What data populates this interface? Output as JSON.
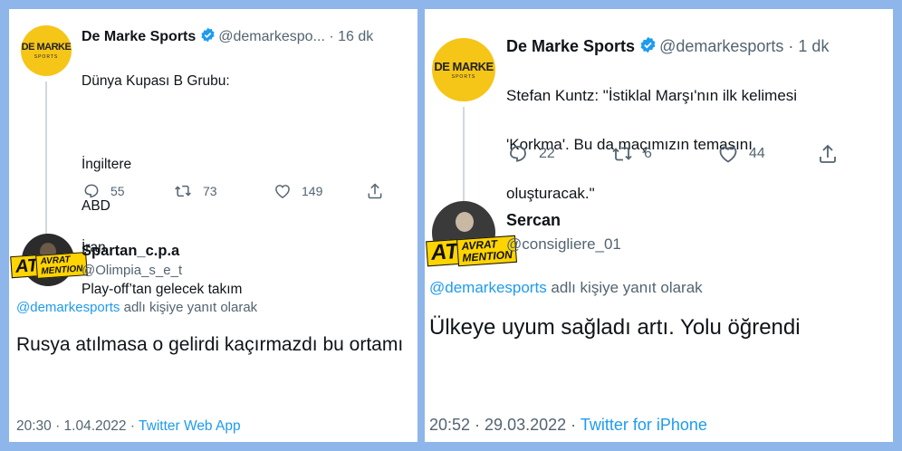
{
  "left": {
    "original": {
      "logo_text": "DE MARKE",
      "logo_sub": "SPORTS",
      "name": "De Marke Sports",
      "handle": "@demarkespo...",
      "separator": "·",
      "time": "16 dk",
      "lines": [
        "Dünya Kupası B Grubu:",
        "",
        "İngiltere",
        "ABD",
        "İran",
        "Play-off’tan gelecek takım"
      ],
      "reply_count": "55",
      "retweet_count": "73",
      "like_count": "149"
    },
    "reply": {
      "badge_top": "AVRAT",
      "badge_bottom": "MENTION",
      "badge_prefix": "AT",
      "name": "Spartan_c.p.a",
      "handle": "@Olimpia_s_e_t",
      "replying_to": "@demarkesports",
      "replying_suffix": " adlı kişiye yanıt olarak",
      "text": "Rusya atılmasa o gelirdi kaçırmazdı bu ortamı",
      "time": "20:30 · 1.04.2022 · ",
      "app": "Twitter Web App"
    }
  },
  "right": {
    "original": {
      "logo_text": "DE MARKE",
      "logo_sub": "SPORTS",
      "name": "De Marke Sports",
      "handle": "@demarkesports",
      "separator": "·",
      "time": "1 dk",
      "lines": [
        "Stefan Kuntz: \"İstiklal Marşı'nın ilk kelimesi",
        "'Korkma'. Bu da maçımızın temasını",
        "oluşturacak.\""
      ],
      "reply_count": "22",
      "retweet_count": "6",
      "like_count": "44"
    },
    "reply": {
      "badge_top": "AVRAT",
      "badge_bottom": "MENTION",
      "badge_prefix": "AT",
      "name": "Sercan",
      "handle": "@consigliere_01",
      "replying_to": "@demarkesports",
      "replying_suffix": " adlı kişiye yanıt olarak",
      "text": "Ülkeye uyum sağladı artı. Yolu öğrendi",
      "time": "20:52 · 29.03.2022 · ",
      "app": "Twitter for iPhone"
    }
  },
  "colors": {
    "accent": "#1d9bf0",
    "logo": "#f5c518",
    "background": "#8fb6ea"
  }
}
